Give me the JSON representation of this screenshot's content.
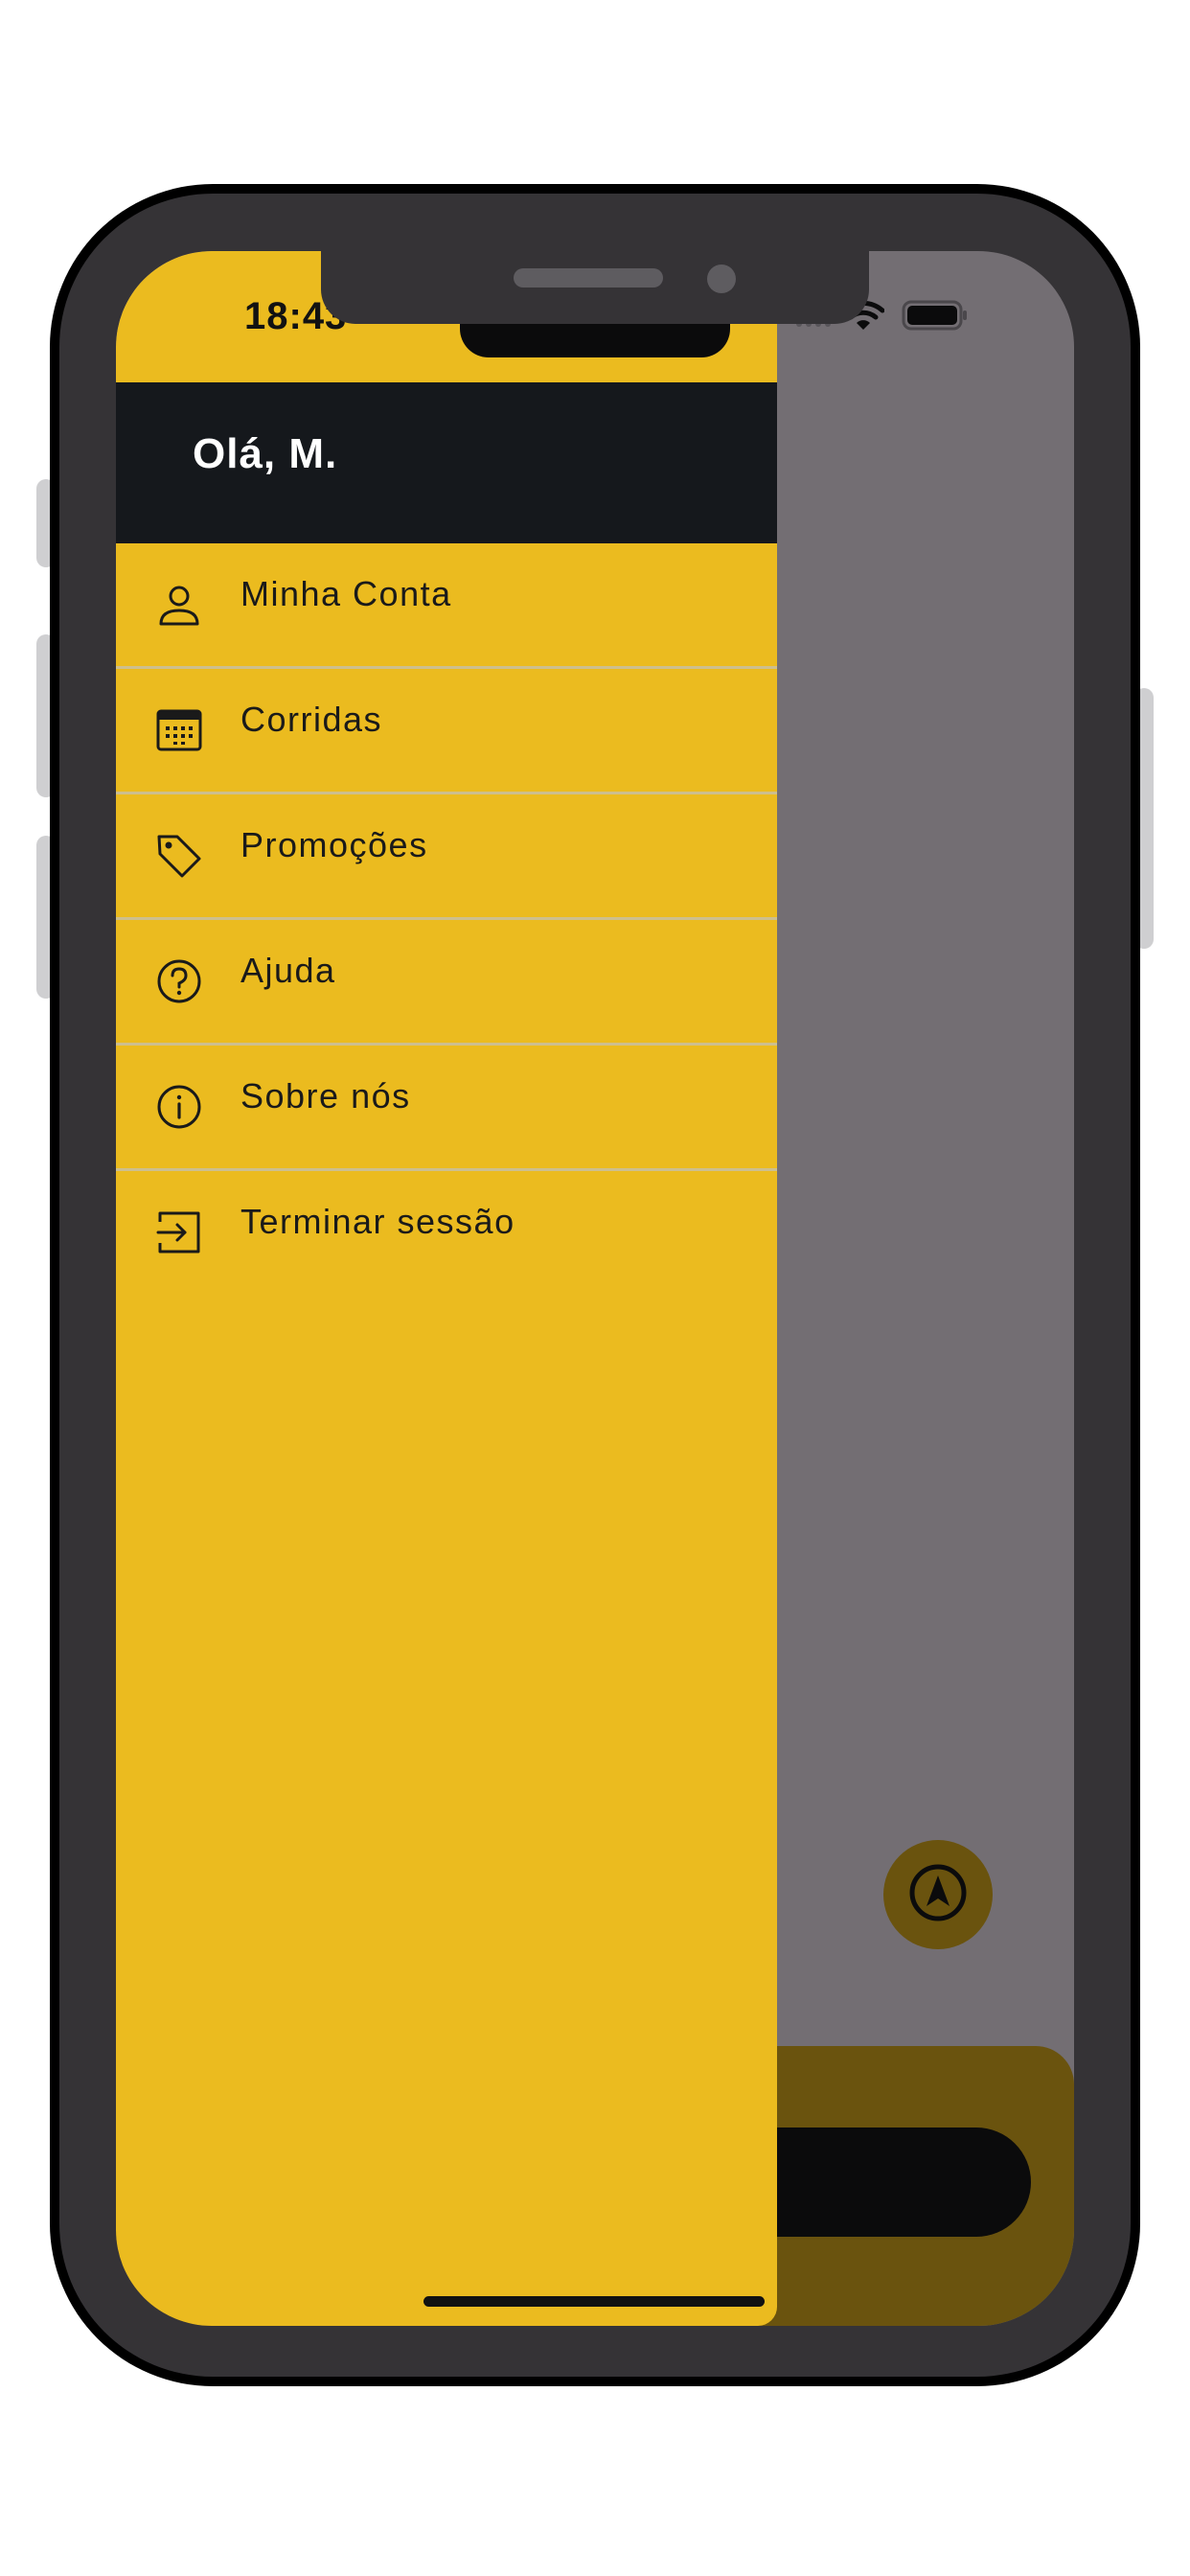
{
  "status_bar": {
    "time": "18:43"
  },
  "drawer": {
    "greeting": "Olá, M.",
    "items": [
      {
        "id": "account",
        "label": "Minha Conta",
        "icon": "person-icon"
      },
      {
        "id": "rides",
        "label": "Corridas",
        "icon": "calendar-icon"
      },
      {
        "id": "promotions",
        "label": "Promoções",
        "icon": "tag-icon"
      },
      {
        "id": "help",
        "label": "Ajuda",
        "icon": "help-circle-icon"
      },
      {
        "id": "about",
        "label": "Sobre nós",
        "icon": "info-circle-icon"
      },
      {
        "id": "logout",
        "label": "Terminar sessão",
        "icon": "logout-icon"
      }
    ]
  },
  "colors": {
    "drawer_background": "#ebbb1f",
    "header_background": "#15181c",
    "overlay": "#736e73",
    "text_dark": "#1a1a1a"
  }
}
